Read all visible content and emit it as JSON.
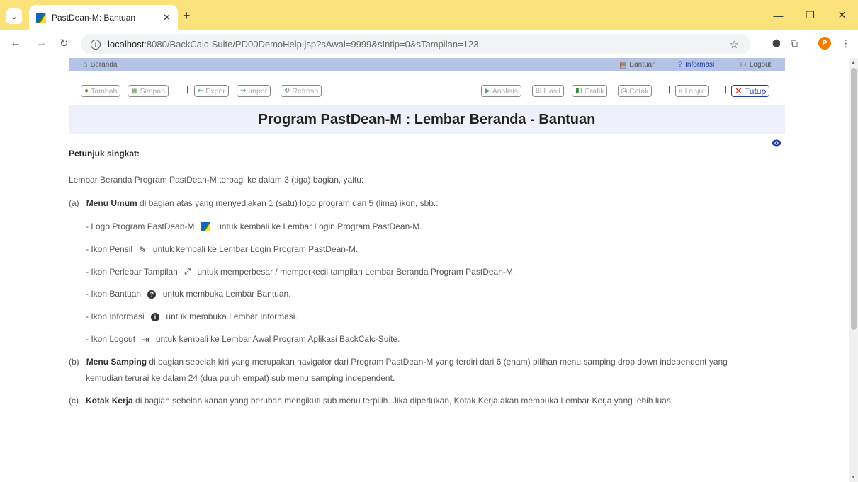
{
  "browser": {
    "tab_title": "PastDean-M: Bantuan",
    "url_host": "localhost",
    "url_path": ":8080/BackCalc-Suite/PD00DemoHelp.jsp?sAwal=9999&sIntip=0&sTampilan=123",
    "avatar_letter": "P"
  },
  "topnav": {
    "home": "Beranda",
    "help": "Bantuan",
    "info": "Informasi",
    "logout": "Logout"
  },
  "toolbar": {
    "add": "Tambah",
    "save": "Simpan",
    "export": "Expor",
    "import": "Impor",
    "refresh": "Refresh",
    "analysis": "Analisis",
    "result": "Hasil",
    "graph": "Grafik",
    "print": "Cetak",
    "next": "Lanjut",
    "close": "Tutup",
    "separator": "|"
  },
  "page": {
    "title": "Program PastDean-M : Lembar Beranda - Bantuan",
    "heading": "Petunjuk singkat:",
    "intro": "Lembar Beranda Program PastDean-M terbagi ke dalam 3 (tiga) bagian, yaitu:",
    "a_prefix": "(a)",
    "a_bold": "Menu Umum",
    "a_text": " di bagian atas yang menyediakan 1 (satu) logo program dan 5 (lima) ikon, sbb.:",
    "items": [
      {
        "pre": "-  Logo Program PastDean-M",
        "post": "untuk kembali ke Lembar Login Program PastDean-M.",
        "icon": "logo-icon"
      },
      {
        "pre": "-  Ikon Pensil",
        "post": "untuk kembali ke Lembar Login Program PastDean-M.",
        "icon": "pencil-icon"
      },
      {
        "pre": "-  Ikon Perlebar Tampilan",
        "post": "untuk memperbesar / memperkecil tampilan Lembar Beranda Program PastDean-M.",
        "icon": "expand-icon"
      },
      {
        "pre": "-  Ikon Bantuan",
        "post": "untuk membuka Lembar Bantuan.",
        "icon": "question-icon"
      },
      {
        "pre": "-  Ikon Informasi",
        "post": "untuk membuka Lembar Informasi.",
        "icon": "info-icon"
      },
      {
        "pre": "-  Ikon Logout",
        "post": "untuk kembali ke Lembar Awal Program Aplikasi BackCalc-Suite.",
        "icon": "logout-icon"
      }
    ],
    "b_prefix": "(b)",
    "b_bold": "Menu Samping",
    "b_text": " di bagian sebelah kiri yang merupakan navigator dari Program PastDean-M yang terdiri dari 6 (enam) pilihan menu samping drop down independent yang",
    "b_text2": "kemudian terurai ke dalam 24 (dua puluh empat) sub menu samping independent.",
    "c_prefix": "(c)",
    "c_bold": "Kotak Kerja",
    "c_text": " di bagian sebelah kanan yang berubah mengikuti sub menu terpilih. Jika diperlukan, Kotak Kerja akan membuka Lembar Kerja yang lebih luas."
  }
}
